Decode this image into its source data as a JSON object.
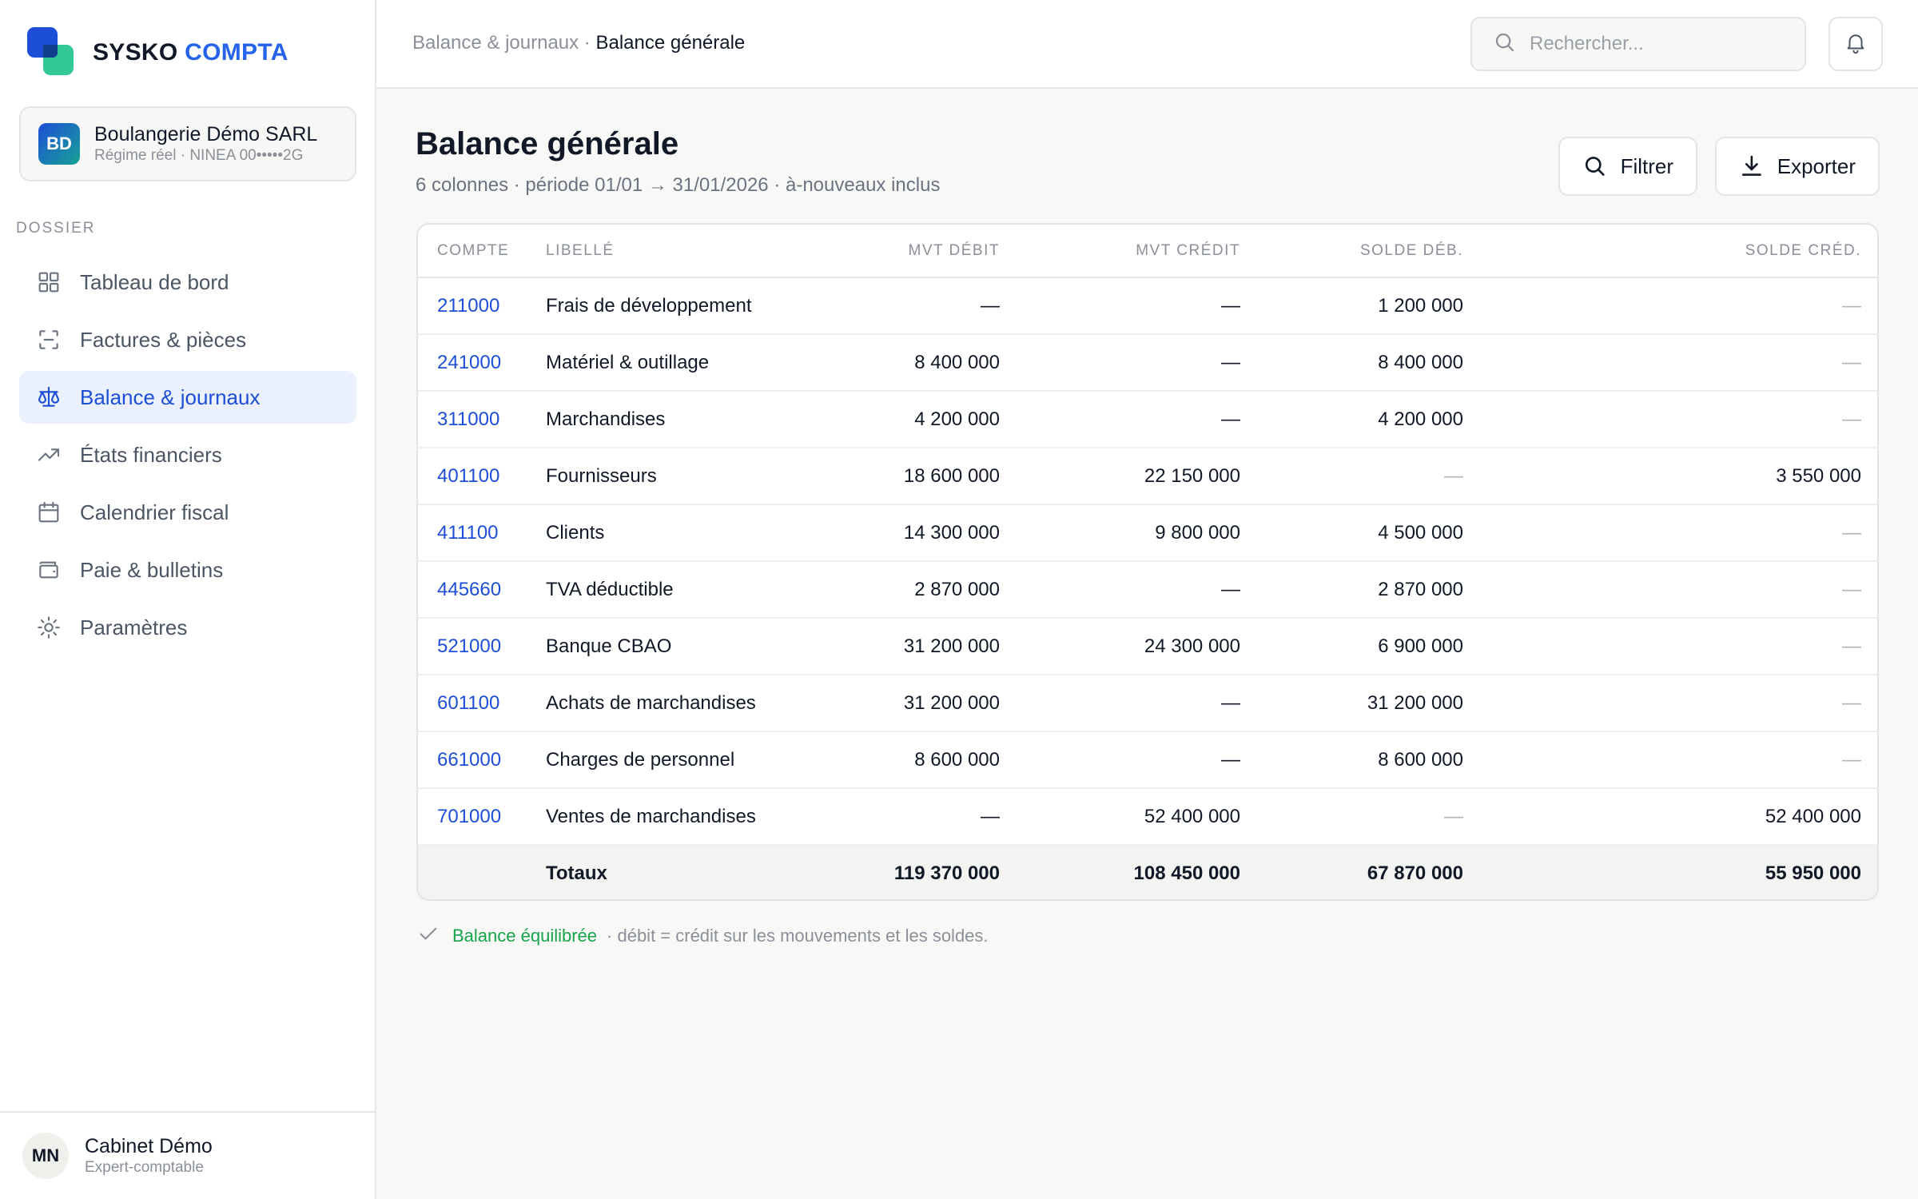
{
  "brand": {
    "part1": "SYSKO",
    "part2": "COMPTA"
  },
  "org": {
    "initials": "BD",
    "name": "Boulangerie Démo SARL",
    "subtitle": "Régime réel · NINEA 00•••••2G"
  },
  "sidebar": {
    "section_label": "DOSSIER",
    "items": [
      {
        "label": "Tableau de bord",
        "icon": "grid-icon",
        "active": false
      },
      {
        "label": "Factures & pièces",
        "icon": "scan-icon",
        "active": false
      },
      {
        "label": "Balance & journaux",
        "icon": "scale-icon",
        "active": true
      },
      {
        "label": "États financiers",
        "icon": "trending-up-icon",
        "active": false
      },
      {
        "label": "Calendrier fiscal",
        "icon": "calendar-icon",
        "active": false
      },
      {
        "label": "Paie & bulletins",
        "icon": "wallet-icon",
        "active": false
      },
      {
        "label": "Paramètres",
        "icon": "sun-gear-icon",
        "active": false
      }
    ]
  },
  "user": {
    "initials": "MN",
    "name": "Cabinet Démo",
    "role": "Expert-comptable"
  },
  "topbar": {
    "breadcrumb_parent": "Balance & journaux",
    "breadcrumb_sep": " · ",
    "breadcrumb_current": "Balance générale",
    "search_placeholder": "Rechercher..."
  },
  "page": {
    "title": "Balance générale",
    "subtitle": "6 colonnes · période 01/01 → 31/01/2026 · à-nouveaux inclus",
    "filter_label": "Filtrer",
    "export_label": "Exporter"
  },
  "table": {
    "headers": [
      "COMPTE",
      "LIBELLÉ",
      "MVT DÉBIT",
      "MVT CRÉDIT",
      "SOLDE DÉB.",
      "SOLDE CRÉD."
    ],
    "rows": [
      [
        "211000",
        "Frais de développement",
        "—",
        "—",
        "1 200 000",
        "—"
      ],
      [
        "241000",
        "Matériel & outillage",
        "8 400 000",
        "—",
        "8 400 000",
        "—"
      ],
      [
        "311000",
        "Marchandises",
        "4 200 000",
        "—",
        "4 200 000",
        "—"
      ],
      [
        "401100",
        "Fournisseurs",
        "18 600 000",
        "22 150 000",
        "—",
        "3 550 000"
      ],
      [
        "411100",
        "Clients",
        "14 300 000",
        "9 800 000",
        "4 500 000",
        "—"
      ],
      [
        "445660",
        "TVA déductible",
        "2 870 000",
        "—",
        "2 870 000",
        "—"
      ],
      [
        "521000",
        "Banque CBAO",
        "31 200 000",
        "24 300 000",
        "6 900 000",
        "—"
      ],
      [
        "601100",
        "Achats de marchandises",
        "31 200 000",
        "—",
        "31 200 000",
        "—"
      ],
      [
        "661000",
        "Charges de personnel",
        "8 600 000",
        "—",
        "8 600 000",
        "—"
      ],
      [
        "701000",
        "Ventes de marchandises",
        "—",
        "52 400 000",
        "—",
        "52 400 000"
      ]
    ],
    "totals": [
      "",
      "Totaux",
      "119 370 000",
      "108 450 000",
      "67 870 000",
      "55 950 000"
    ]
  },
  "footnote": {
    "status": "Balance équilibrée",
    "detail": "· débit = crédit sur les mouvements et les soldes."
  },
  "colors": {
    "accent": "#1d4ed8",
    "success": "#16a34a",
    "muted": "#8a8f98"
  }
}
